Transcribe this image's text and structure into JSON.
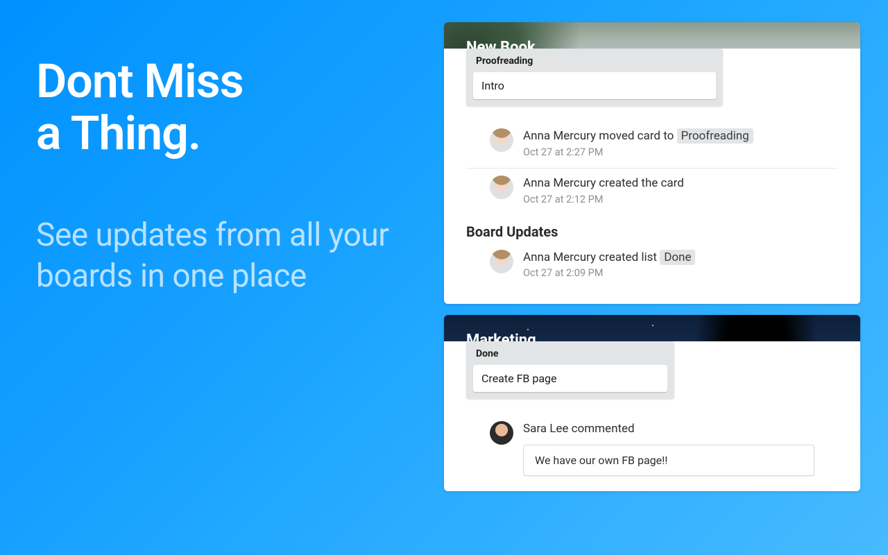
{
  "copy": {
    "headline_line1": "Dont Miss",
    "headline_line2": "a Thing.",
    "subhead": "See updates from all your boards in one place"
  },
  "panels": [
    {
      "title": "New Book",
      "list": {
        "title": "Proofreading",
        "card": "Intro"
      },
      "activity": [
        {
          "user": "Anna Mercury",
          "avatar": "anna",
          "action_prefix": " moved card to ",
          "tag": "Proofreading",
          "time": "Oct 27 at 2:27 PM"
        },
        {
          "user": "Anna Mercury",
          "avatar": "anna",
          "action_prefix": " created the card",
          "tag": "",
          "time": "Oct 27 at 2:12 PM"
        }
      ],
      "section_heading": "Board Updates",
      "board_updates": [
        {
          "user": "Anna Mercury",
          "avatar": "anna",
          "action_prefix": " created list ",
          "tag": "Done",
          "time": "Oct 27 at 2:09 PM"
        }
      ]
    },
    {
      "title": "Marketing",
      "list": {
        "title": "Done",
        "card": "Create FB page"
      },
      "activity": [
        {
          "user": "Sara Lee",
          "avatar": "sara",
          "action_prefix": " commented",
          "tag": "",
          "time": "",
          "comment": "We have our own FB page!!"
        }
      ]
    }
  ]
}
